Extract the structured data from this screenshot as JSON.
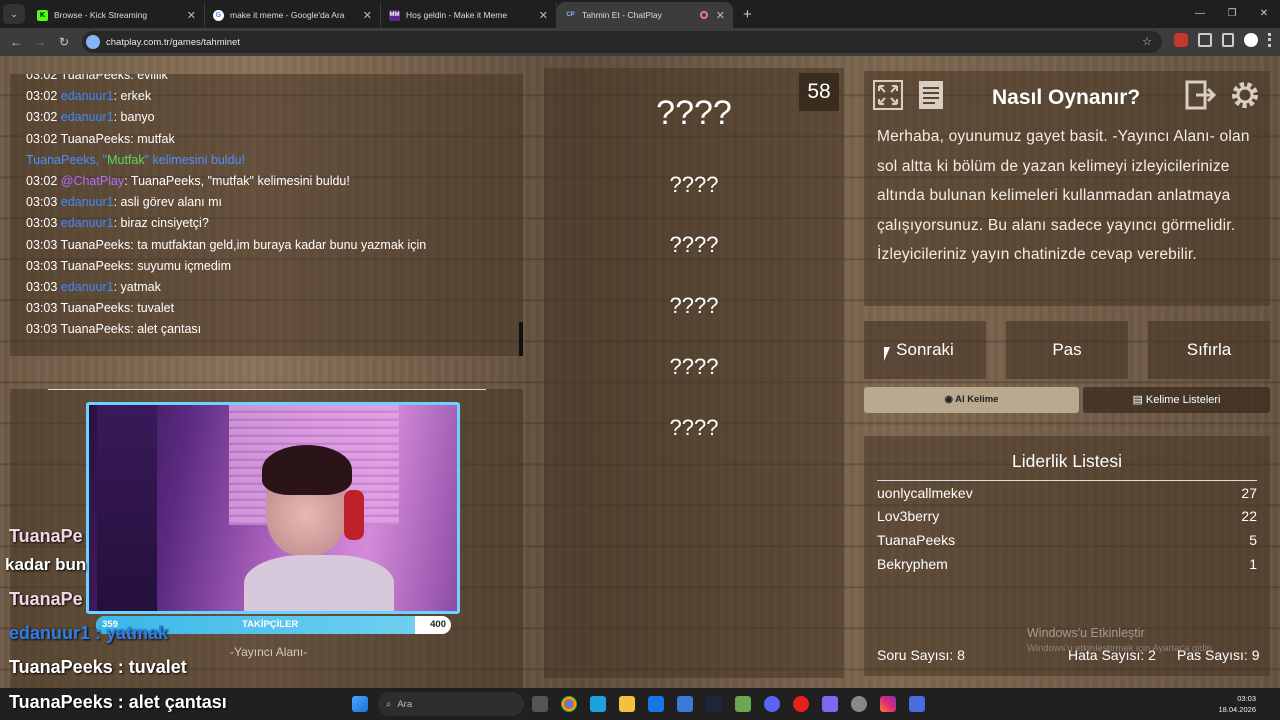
{
  "browser": {
    "tabs": [
      {
        "label": "Browse - Kick Streaming",
        "favicon": "K",
        "favicon_color": "#53fc18"
      },
      {
        "label": "make it meme - Google'da Ara",
        "favicon": "G",
        "favicon_color": "#ffffff"
      },
      {
        "label": "Hoş geldin - Make it Meme",
        "favicon": "MM",
        "favicon_color": "#b46cff"
      },
      {
        "label": "Tahmin Et - ChatPlay",
        "favicon": "CP",
        "favicon_color": "#8ab4f8"
      }
    ],
    "url": "chatplay.com.tr/games/tahminet"
  },
  "chat": {
    "messages": [
      {
        "time": "03:02",
        "user": "TuanaPeeks",
        "color": "white",
        "text": "evlilik"
      },
      {
        "time": "03:02",
        "user": "edanuur1",
        "color": "blue",
        "text": "erkek"
      },
      {
        "time": "03:02",
        "user": "edanuur1",
        "color": "blue",
        "text": "banyo"
      },
      {
        "time": "03:02",
        "user": "TuanaPeeks",
        "color": "white",
        "text": "mutfak"
      },
      {
        "time": "",
        "user": "",
        "color": "system",
        "text": "TuanaPeeks, \"Mutfak\" kelimesini buldu!"
      },
      {
        "time": "03:02",
        "user": "@ChatPlay",
        "color": "purple",
        "text": "TuanaPeeks, \"mutfak\" kelimesini buldu!"
      },
      {
        "time": "03:03",
        "user": "edanuur1",
        "color": "blue",
        "text": "asli görev alanı mı"
      },
      {
        "time": "03:03",
        "user": "edanuur1",
        "color": "blue",
        "text": "biraz cinsiyetçi?"
      },
      {
        "time": "03:03",
        "user": "TuanaPeeks",
        "color": "white",
        "text": "ta mutfaktan geld,im buraya kadar bunu yazmak için"
      },
      {
        "time": "03:03",
        "user": "TuanaPeeks",
        "color": "white",
        "text": "suyumu içmedim"
      },
      {
        "time": "03:03",
        "user": "edanuur1",
        "color": "blue",
        "text": "yatmak"
      },
      {
        "time": "03:03",
        "user": "TuanaPeeks",
        "color": "white",
        "text": "tuvalet"
      },
      {
        "time": "03:03",
        "user": "TuanaPeeks",
        "color": "white",
        "text": "alet çantası"
      }
    ],
    "system_prefix": "TuanaPeeks, \"",
    "system_word": "Mutfak",
    "system_suffix": "\" kelimesini buldu!"
  },
  "stream_overlay": {
    "followers_label": "TAKİPÇİLER",
    "followers_current": "359",
    "followers_goal": "400",
    "followers_progress": 0.8975,
    "presenter_area": "-Yayıncı Alanı-",
    "lines": [
      {
        "text": "TuanaPe",
        "style": "pink"
      },
      {
        "text": "kadar bun",
        "style": "white"
      },
      {
        "text": "TuanaPe",
        "style": "pink"
      },
      {
        "text": "edanuur1 : yatmak",
        "style": "blue"
      },
      {
        "text": "TuanaPeeks : tuvalet",
        "style": "white"
      },
      {
        "text": "TuanaPeeks : alet çantası",
        "style": "white"
      }
    ]
  },
  "game": {
    "timer": "58",
    "words": [
      "????",
      "????",
      "????",
      "????",
      "????",
      "????"
    ]
  },
  "howto": {
    "title": "Nasıl Oynanır?",
    "text": "Merhaba, oyunumuz gayet basit. -Yayıncı Alanı- olan sol altta ki bölüm de yazan kelimeyi izleyicilerinize altında bulunan kelimeleri kullanmadan anlatmaya çalışıyorsunuz. Bu alanı sadece yayıncı görmelidir. İzleyicileriniz yayın chatinizde cevap verebilir."
  },
  "actions": {
    "next": "Sonraki",
    "pass": "Pas",
    "reset": "Sıfırla",
    "ai_word": "Al Kelime",
    "word_lists": "Kelime Listeleri"
  },
  "leaderboard": {
    "title": "Liderlik Listesi",
    "rows": [
      {
        "name": "uonlycallmekev",
        "score": "27"
      },
      {
        "name": "Lov3berry",
        "score": "22"
      },
      {
        "name": "TuanaPeeks",
        "score": "5"
      },
      {
        "name": "Bekryphem",
        "score": "1"
      }
    ]
  },
  "stats": {
    "questions": "Soru Sayısı: 8",
    "errors": "Hata Sayısı: 2",
    "passes": "Pas Sayısı: 9"
  },
  "watermark": {
    "title": "Windows'u Etkinleştir",
    "subtitle": "Windows'u etkinleştirmek için Ayarlar'a gidin."
  },
  "taskbar": {
    "search_placeholder": "Ara",
    "time": "03:03",
    "date": "18.04.2026"
  }
}
